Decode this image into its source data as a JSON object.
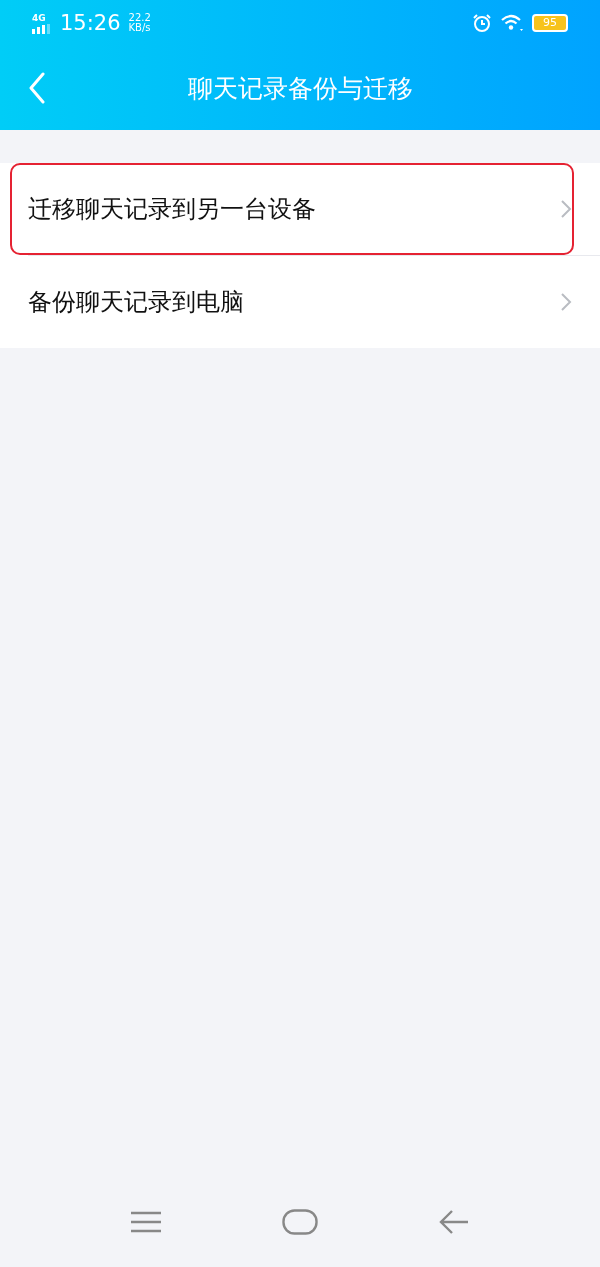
{
  "status_bar": {
    "network": "4G",
    "time": "15:26",
    "speed_value": "22.2",
    "speed_unit": "KB/s",
    "battery": "95"
  },
  "header": {
    "title": "聊天记录备份与迁移"
  },
  "items": [
    {
      "label": "迁移聊天记录到另一台设备",
      "highlighted": true
    },
    {
      "label": "备份聊天记录到电脑",
      "highlighted": false
    }
  ]
}
